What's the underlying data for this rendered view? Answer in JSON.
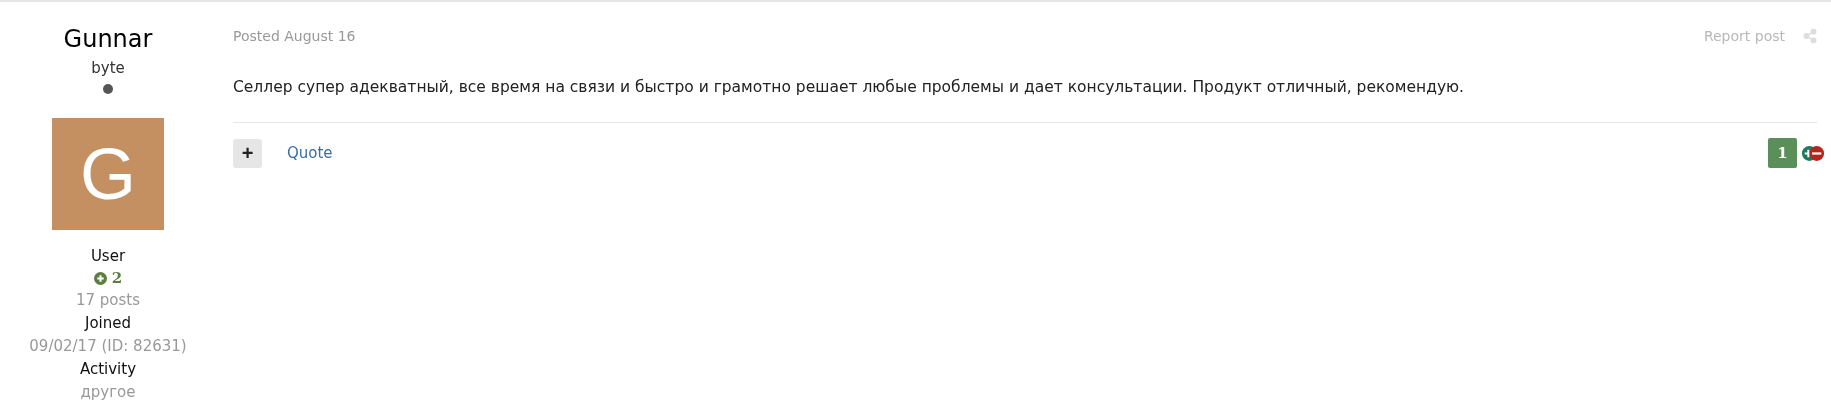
{
  "author": {
    "name": "Gunnar",
    "group_title": "byte",
    "online": false,
    "avatar_letter": "G",
    "rank": "User",
    "reputation": "2",
    "posts": "17 posts",
    "joined_label": "Joined",
    "joined_value": "09/02/17 (ID: 82631)",
    "activity_label": "Activity",
    "activity_value": "другое"
  },
  "post": {
    "posted": "Posted August 16",
    "report": "Report post",
    "body": "Селлер супер адекватный, все время на связи и быстро и грамотно решает любые проблемы и дает консультации. Продукт отличный, рекомендую.",
    "multiquote": "+",
    "quote": "Quote",
    "reputation_count": "1"
  }
}
